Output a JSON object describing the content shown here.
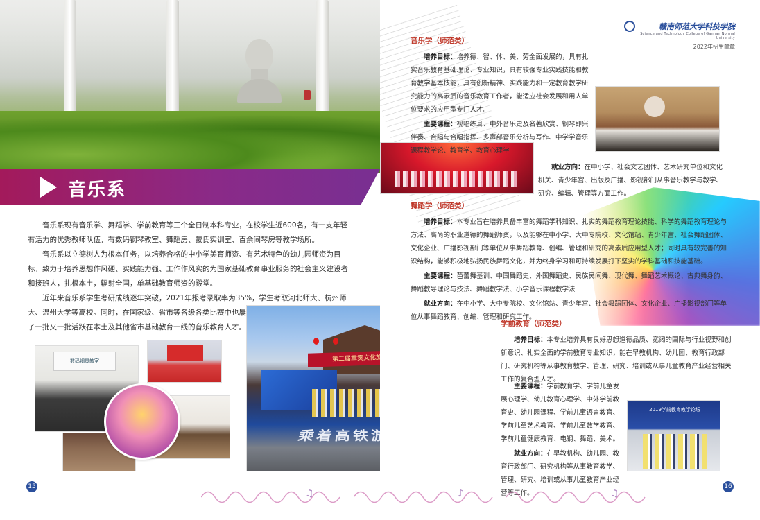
{
  "left_page": {
    "section_title": "音乐系",
    "intro_paragraphs": [
      "音乐系现有音乐学、舞蹈学、学前教育等三个全日制本科专业，在校学生近600名，有一支年轻有活力的优秀教师队伍，有数码钢琴教室、舞蹈房、蒙氏实训室、百余间琴房等教学场所。",
      "音乐系以立德树人为根本任务，以培养合格的中小学美育师资、有艺术特色的幼儿园师资为目标，致力于培养思想作风硬、实践能力强、工作作风实的为国家基础教育事业服务的社会主义建设者和接班人，扎根本土，辐射全国，单基础教育师资的殿堂。",
      "近年来音乐系学生考研成绩逐年突破，2021年报考录取率为35%，学生考取河北师大、杭州师大、温州大学等高校。同时，在国家级、省市等各级各类比赛中也屡获佳绩。办学以来，为国家培养了一批又一批活跃在本土及其他省市基础教育一线的音乐教育人才。"
    ],
    "photo_labels": {
      "classroom_sign": "数码钢琴教室",
      "stage_banner": "第二届章贡文化旅游节",
      "stage_slogan": "乘着高铁游章贡"
    },
    "page_number": "15"
  },
  "right_page": {
    "school_name": "赣南师范大学科技学院",
    "school_name_en": "Science and Technology College of Gannan Normal University",
    "brochure_year": "2022年招生简章",
    "programs": [
      {
        "name": "音乐学（师范类）",
        "goal_label": "培养目标：",
        "goal": "培养德、智、体、美、劳全面发展的，具有扎实音乐教育基础理论、专业知识，具有较强专业实践技能和教育教学基本技能，具有创新精神、实践能力和一定教育教学研究能力的高素质的音乐教育工作者，能适应社会发展和用人单位要求的应用型专门人才。",
        "courses_label": "主要课程：",
        "courses": "视唱练耳、中外音乐史及名著欣赏、钢琴即兴伴奏、合唱与合唱指挥、多声部音乐分析与写作、中学学音乐课程教学论、教育学、教育心理学",
        "career_label": "就业方向：",
        "career": "在中小学、社会文艺团体、艺术研究单位和文化机关、青少年宫、出版及广播、影视部门从事音乐教学与教学、研究、编辑、管理等方面工作。"
      },
      {
        "name": "舞蹈学（师范类）",
        "goal_label": "培养目标：",
        "goal": "本专业旨在培养具备丰富的舞蹈学科知识、扎实的舞蹈教育理论技能、科学的舞蹈教育理论与方法、高尚的职业道德的舞蹈师资，以及能够在中小学、大中专院校、文化馆站、青少年宫、社会舞蹈团体、文化企业、广播影视部门等单位从事舞蹈教育、创编、管理和研究的高素质应用型人才；同时具有较完善的知识结构，能够积极地弘扬民族舞蹈文化，并为终身学习和可持续发展打下坚实的学科基础和技能基础。",
        "courses_label": "主要课程：",
        "courses": "芭蕾舞基训、中国舞蹈史、外国舞蹈史、民族民间舞、现代舞、舞蹈艺术概论、古典舞身韵、舞蹈教导理论与技法、舞蹈教学法、小学音乐课程教学法",
        "career_label": "就业方向：",
        "career": "在中小学、大中专院校、文化馆站、青少年宫、社会舞蹈团体、文化企业、广播影视部门等单位从事舞蹈教育、创编、管理和研究工作。"
      },
      {
        "name": "学前教育（师范类）",
        "goal_label": "培养目标：",
        "goal": "本专业培养具有良好思想道德品质、宽阔的国际与行业视野和创新意识、扎实全面的学前教育专业知识，能在早教机构、幼儿园、教育行政部门、研究机构等从事教育教学、管理、研究、培训或从事儿童教育产业经营相关工作的复合型人才。",
        "courses_label": "主要课程：",
        "courses": "学前教育学、学前儿童发展心理学、幼儿教育心理学、中外学前教育史、幼儿园课程、学前儿童语言教育、学前儿童艺术教育、学前儿童数学教育、学前儿童健康教育、电钢、舞蹈、美术。",
        "career_label": "就业方向：",
        "career": "在早教机构、幼儿园、教育行政部门、研究机构等从事教育教学、管理、研究、培训或从事儿童教育产业经营等工作。"
      }
    ],
    "photo_labels": {
      "forum_title": "2019学前教育教学论坛"
    },
    "page_number": "16"
  },
  "colors": {
    "title_band_start": "#a31a5b",
    "title_band_end": "#7a2f91",
    "program_heading": "#c0392b",
    "brand_blue": "#2a4f9c"
  }
}
